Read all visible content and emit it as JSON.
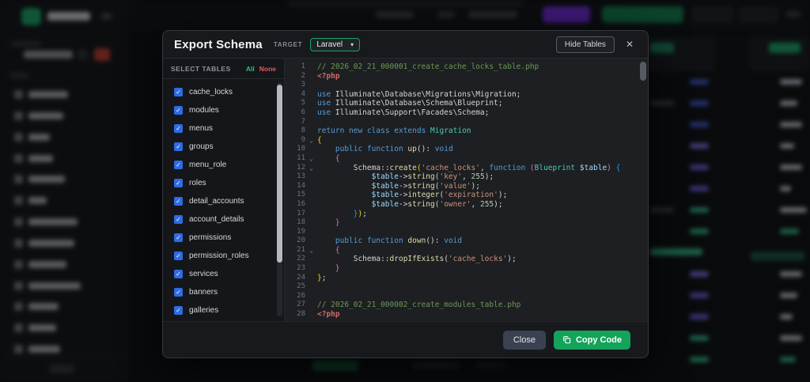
{
  "modal": {
    "title": "Export Schema",
    "target_label": "TARGET",
    "target_value": "Laravel",
    "hide_tables_label": "Hide Tables",
    "close_icon": "✕",
    "panel": {
      "header": "SELECT TABLES",
      "all_label": "All",
      "none_label": "None",
      "checkbox_glyph": "✓"
    },
    "tables": [
      "cache_locks",
      "modules",
      "menus",
      "groups",
      "menu_role",
      "roles",
      "detail_accounts",
      "account_details",
      "permissions",
      "permission_roles",
      "services",
      "banners",
      "galleries"
    ],
    "footer": {
      "close_label": "Close",
      "copy_label": "Copy Code"
    }
  },
  "colors": {
    "accent_green": "#14a35a",
    "checkbox_blue": "#2e6be5",
    "all_green": "#27c08a",
    "none_red": "#e05b5b",
    "select_border_green": "#12a564"
  },
  "code": {
    "fold_glyph": "⌄",
    "lines": [
      {
        "t": [
          [
            "// 2026_02_21_000001_create_cache_locks_table.php",
            "cmt"
          ]
        ]
      },
      {
        "t": [
          [
            "<?php",
            "php"
          ]
        ]
      },
      {
        "t": []
      },
      {
        "t": [
          [
            "use ",
            "kw"
          ],
          [
            "Illuminate\\Database\\Migrations\\Migration;",
            "pln"
          ]
        ]
      },
      {
        "t": [
          [
            "use ",
            "kw"
          ],
          [
            "Illuminate\\Database\\Schema\\Blueprint;",
            "pln"
          ]
        ]
      },
      {
        "t": [
          [
            "use ",
            "kw"
          ],
          [
            "Illuminate\\Support\\Facades\\Schema;",
            "pln"
          ]
        ]
      },
      {
        "t": []
      },
      {
        "t": [
          [
            "return ",
            "kw"
          ],
          [
            "new ",
            "kw"
          ],
          [
            "class ",
            "kw"
          ],
          [
            "extends ",
            "kw"
          ],
          [
            "Migration",
            "cls"
          ]
        ]
      },
      {
        "f": true,
        "t": [
          [
            "{",
            "b1"
          ]
        ]
      },
      {
        "t": [
          [
            "    ",
            "pln"
          ],
          [
            "public ",
            "kw"
          ],
          [
            "function ",
            "kw"
          ],
          [
            "up",
            "fn"
          ],
          [
            "()",
            "pln"
          ],
          [
            ": ",
            "pln"
          ],
          [
            "void",
            "kw"
          ]
        ]
      },
      {
        "f": true,
        "t": [
          [
            "    ",
            "pln"
          ],
          [
            "{",
            "b2"
          ]
        ]
      },
      {
        "f": true,
        "t": [
          [
            "        ",
            "pln"
          ],
          [
            "Schema",
            "pln"
          ],
          [
            "::",
            "pln"
          ],
          [
            "create",
            "fn"
          ],
          [
            "(",
            "b1"
          ],
          [
            "'cache_locks'",
            "str"
          ],
          [
            ", ",
            "pln"
          ],
          [
            "function ",
            "kw"
          ],
          [
            "(",
            "b2"
          ],
          [
            "Blueprint ",
            "cls"
          ],
          [
            "$table",
            "var"
          ],
          [
            ")",
            "b2"
          ],
          [
            " ",
            "pln"
          ],
          [
            "{",
            "b3"
          ]
        ]
      },
      {
        "t": [
          [
            "            ",
            "pln"
          ],
          [
            "$table",
            "var"
          ],
          [
            "->",
            "pln"
          ],
          [
            "string",
            "fn"
          ],
          [
            "(",
            "pln"
          ],
          [
            "'key'",
            "str"
          ],
          [
            ", ",
            "pln"
          ],
          [
            "255",
            "num"
          ],
          [
            ");",
            "pln"
          ]
        ]
      },
      {
        "t": [
          [
            "            ",
            "pln"
          ],
          [
            "$table",
            "var"
          ],
          [
            "->",
            "pln"
          ],
          [
            "string",
            "fn"
          ],
          [
            "(",
            "pln"
          ],
          [
            "'value'",
            "str"
          ],
          [
            ");",
            "pln"
          ]
        ]
      },
      {
        "t": [
          [
            "            ",
            "pln"
          ],
          [
            "$table",
            "var"
          ],
          [
            "->",
            "pln"
          ],
          [
            "integer",
            "fn"
          ],
          [
            "(",
            "pln"
          ],
          [
            "'expiration'",
            "str"
          ],
          [
            ");",
            "pln"
          ]
        ]
      },
      {
        "t": [
          [
            "            ",
            "pln"
          ],
          [
            "$table",
            "var"
          ],
          [
            "->",
            "pln"
          ],
          [
            "string",
            "fn"
          ],
          [
            "(",
            "pln"
          ],
          [
            "'owner'",
            "str"
          ],
          [
            ", ",
            "pln"
          ],
          [
            "255",
            "num"
          ],
          [
            ");",
            "pln"
          ]
        ]
      },
      {
        "t": [
          [
            "        ",
            "pln"
          ],
          [
            "}",
            "b3"
          ],
          [
            ")",
            "b1"
          ],
          [
            ";",
            "pln"
          ]
        ]
      },
      {
        "t": [
          [
            "    ",
            "pln"
          ],
          [
            "}",
            "b2"
          ]
        ]
      },
      {
        "t": []
      },
      {
        "t": [
          [
            "    ",
            "pln"
          ],
          [
            "public ",
            "kw"
          ],
          [
            "function ",
            "kw"
          ],
          [
            "down",
            "fn"
          ],
          [
            "()",
            "pln"
          ],
          [
            ": ",
            "pln"
          ],
          [
            "void",
            "kw"
          ]
        ]
      },
      {
        "f": true,
        "t": [
          [
            "    ",
            "pln"
          ],
          [
            "{",
            "b2"
          ]
        ]
      },
      {
        "t": [
          [
            "        ",
            "pln"
          ],
          [
            "Schema",
            "pln"
          ],
          [
            "::",
            "pln"
          ],
          [
            "dropIfExists",
            "fn"
          ],
          [
            "(",
            "pln"
          ],
          [
            "'cache_locks'",
            "str"
          ],
          [
            ");",
            "pln"
          ]
        ]
      },
      {
        "t": [
          [
            "    ",
            "pln"
          ],
          [
            "}",
            "b2"
          ]
        ]
      },
      {
        "t": [
          [
            "}",
            "b1"
          ],
          [
            ";",
            "pln"
          ]
        ]
      },
      {
        "t": []
      },
      {
        "t": []
      },
      {
        "t": [
          [
            "// 2026_02_21_000002_create_modules_table.php",
            "cmt"
          ]
        ]
      },
      {
        "t": [
          [
            "<?php",
            "php"
          ]
        ]
      }
    ]
  }
}
